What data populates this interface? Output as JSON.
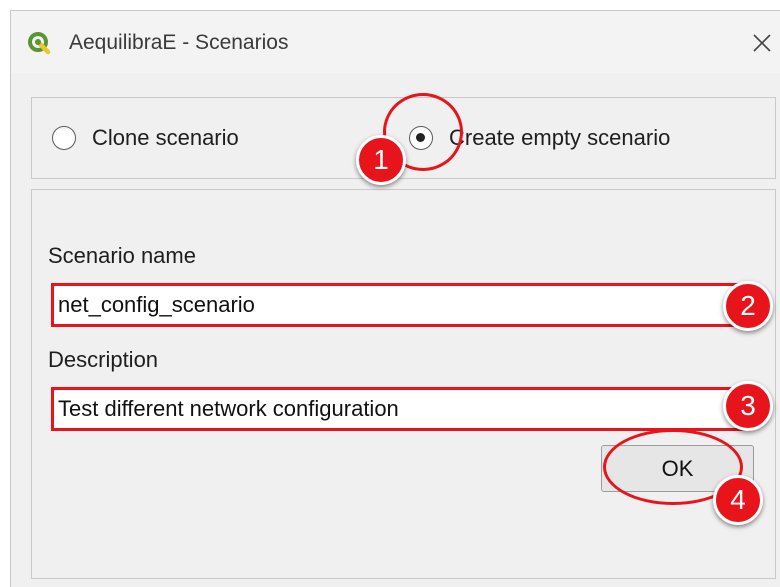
{
  "window": {
    "title": "AequilibraE - Scenarios",
    "icon": "qgis-icon",
    "close_icon": "close-icon"
  },
  "mode": {
    "options": [
      {
        "label": "Clone scenario",
        "checked": false
      },
      {
        "label": "Create empty scenario",
        "checked": true
      }
    ]
  },
  "form": {
    "name_label": "Scenario name",
    "name_value": "net_config_scenario",
    "description_label": "Description",
    "description_value": "Test different network configuration",
    "ok_label": "OK"
  },
  "annotations": {
    "badges": [
      "1",
      "2",
      "3",
      "4"
    ],
    "color": "#e8141b"
  }
}
